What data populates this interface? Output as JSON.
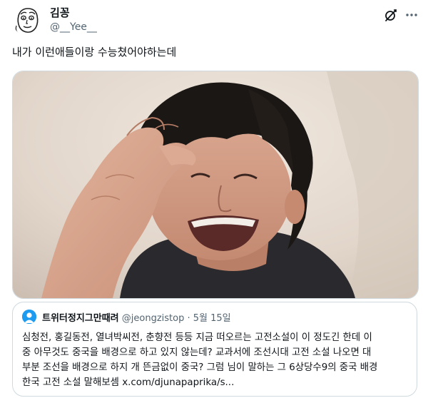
{
  "author": {
    "display_name": "김꽁",
    "handle": "@__Yee__",
    "avatar_icon": "doodle-face-avatar"
  },
  "tweet": {
    "text": "내가 이런애들이랑 수능쳤어야하는데"
  },
  "media": {
    "description_icon": "laughing-person-photo"
  },
  "header_icons": {
    "grok": "grok-icon",
    "more": "more-icon"
  },
  "quote": {
    "display_name": "트위터정지그만때려",
    "handle": "@jeongzistop",
    "separator": "·",
    "date": "5월 15일",
    "lines": [
      "심청전, 홍길동전, 열녀박씨전, 춘향전 등등 지금 떠오르는 고전소설이 이 정도긴 한데 이",
      "중 아무것도 중국을 배경으로 하고 있지 않는데? 교과서에 조선시대 고전 소설 나오면 대",
      "부분 조선을 배경으로 하지 개 뜬금없이 중국? 그럼 님이 말하는 그 6상당수9의 중국 배경",
      "한국 고전 소설 말해보셈 x.com/djunapaprika/s..."
    ]
  },
  "colors": {
    "text_primary": "#0f1419",
    "text_secondary": "#536471",
    "border": "#cfd9de",
    "quote_avatar": "#1d9bf0"
  }
}
